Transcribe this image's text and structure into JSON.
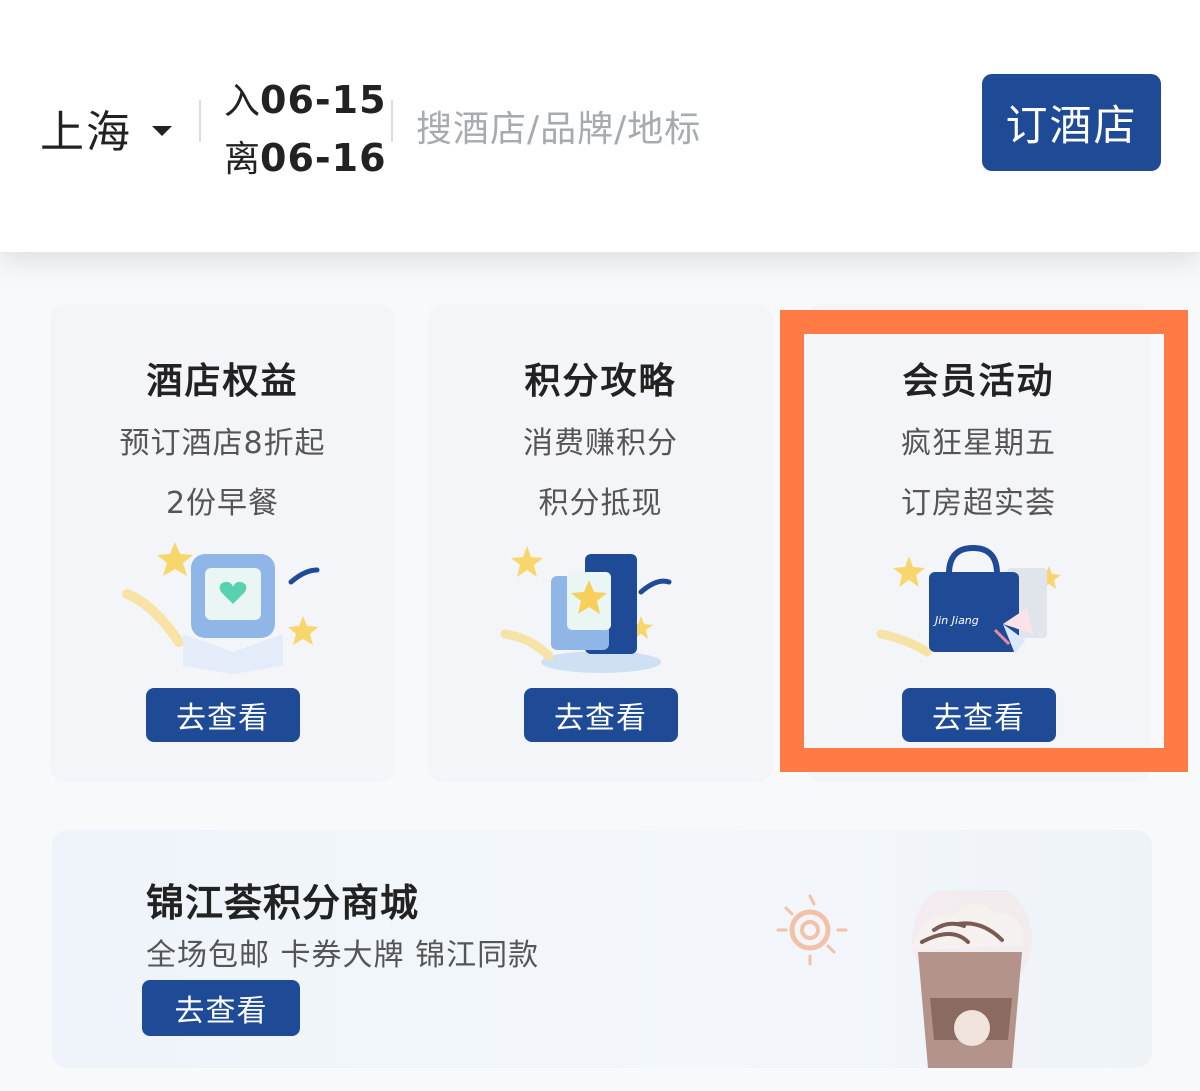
{
  "search": {
    "city": "上海",
    "checkin_prefix": "入",
    "checkin_date": "06-15",
    "checkout_prefix": "离",
    "checkout_date": "06-16",
    "placeholder": "搜酒店/品牌/地标",
    "book_label": "订酒店"
  },
  "cards": [
    {
      "title": "酒店权益",
      "line1": "预订酒店8折起",
      "line2": "2份早餐",
      "button": "去查看",
      "icon": "gift-box-heart-icon"
    },
    {
      "title": "积分攻略",
      "line1": "消费赚积分",
      "line2": "积分抵现",
      "button": "去查看",
      "icon": "star-card-icon"
    },
    {
      "title": "会员活动",
      "line1": "疯狂星期五",
      "line2": "订房超实荟",
      "button": "去查看",
      "icon": "shopping-bag-icon"
    }
  ],
  "highlight": {
    "color": "#ff7a45"
  },
  "mall": {
    "title": "锦江荟积分商城",
    "subtitle": "全场包邮 卡券大牌 锦江同款",
    "button": "去查看",
    "icon": "coffee-drink-icon"
  },
  "brand_text": "Jin Jiang",
  "colors": {
    "primary": "#1f4a96",
    "highlight": "#ff7a45"
  }
}
